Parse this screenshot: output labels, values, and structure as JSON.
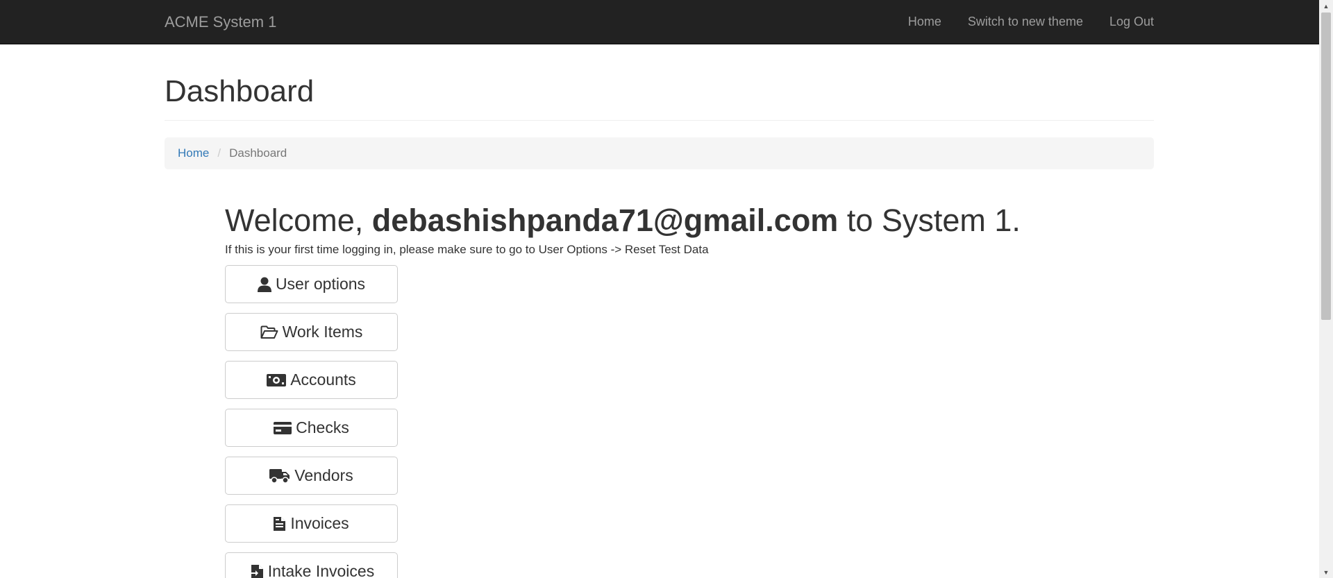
{
  "navbar": {
    "brand": "ACME System 1",
    "links": [
      "Home",
      "Switch to new theme",
      "Log Out"
    ]
  },
  "page": {
    "title": "Dashboard"
  },
  "breadcrumb": {
    "home": "Home",
    "separator": "/",
    "current": "Dashboard"
  },
  "welcome": {
    "prefix": "Welcome,",
    "email": "debashishpanda71@gmail.com",
    "suffix": "to System 1.",
    "hint": "If this is your first time logging in, please make sure to go to User Options -> Reset Test Data"
  },
  "menu": [
    {
      "label": "User options",
      "icon": "user-icon"
    },
    {
      "label": "Work Items",
      "icon": "folder-open-icon"
    },
    {
      "label": "Accounts",
      "icon": "money-icon"
    },
    {
      "label": "Checks",
      "icon": "credit-card-icon"
    },
    {
      "label": "Vendors",
      "icon": "truck-icon"
    },
    {
      "label": "Invoices",
      "icon": "file-text-icon"
    },
    {
      "label": "Intake Invoices",
      "icon": "file-import-icon"
    }
  ],
  "colors": {
    "navbar_bg": "#222222",
    "navbar_text": "#9d9d9d",
    "link": "#337ab7",
    "breadcrumb_bg": "#f5f5f5",
    "text": "#333333"
  }
}
